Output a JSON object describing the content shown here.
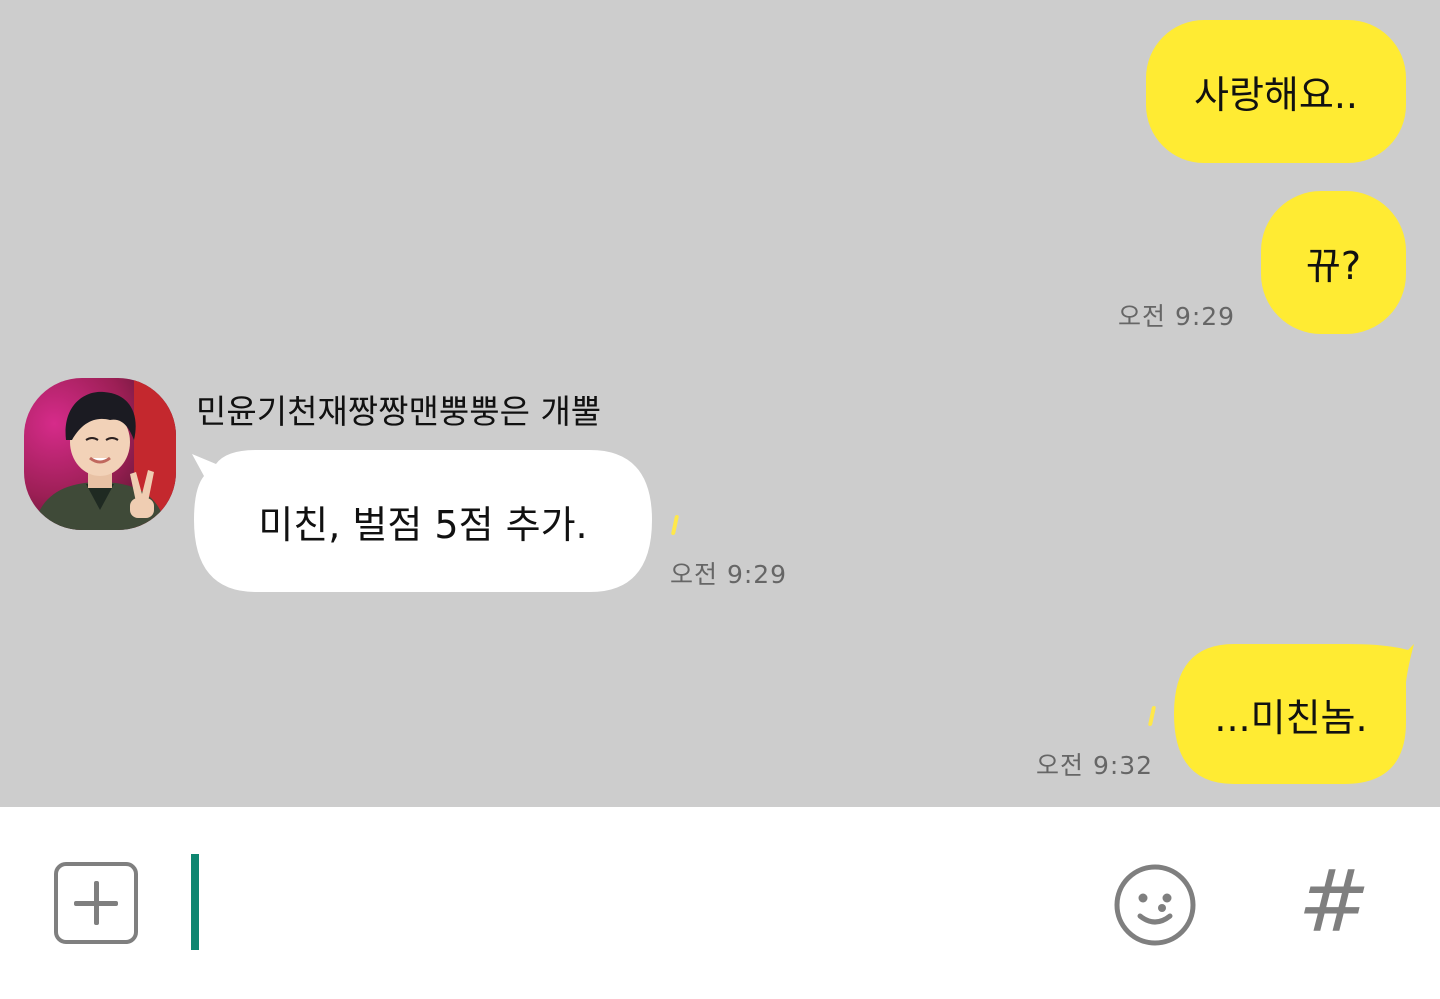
{
  "chat": {
    "messages": [
      {
        "from": "me",
        "text": "사랑해요.."
      },
      {
        "from": "me",
        "text": "뀨?",
        "time": "오전 9:29"
      },
      {
        "from": "other",
        "sender": "민윤기천재짱짱맨뿡뿡은 개뿔",
        "text": "미친, 벌점 5점 추가.",
        "time": "오전 9:29"
      },
      {
        "from": "me",
        "text": "...미친놈.",
        "time": "오전 9:32"
      }
    ]
  },
  "input_bar": {
    "attach_icon": "plus-square-icon",
    "emoji_icon": "smiley-icon",
    "hashtag_label": "#",
    "message_value": ""
  },
  "colors": {
    "chat_background": "#cdcdcd",
    "sent_bubble": "#ffeb33",
    "received_bubble": "#ffffff",
    "cursor": "#0e8670",
    "icon_gray": "#7f7f7f"
  }
}
